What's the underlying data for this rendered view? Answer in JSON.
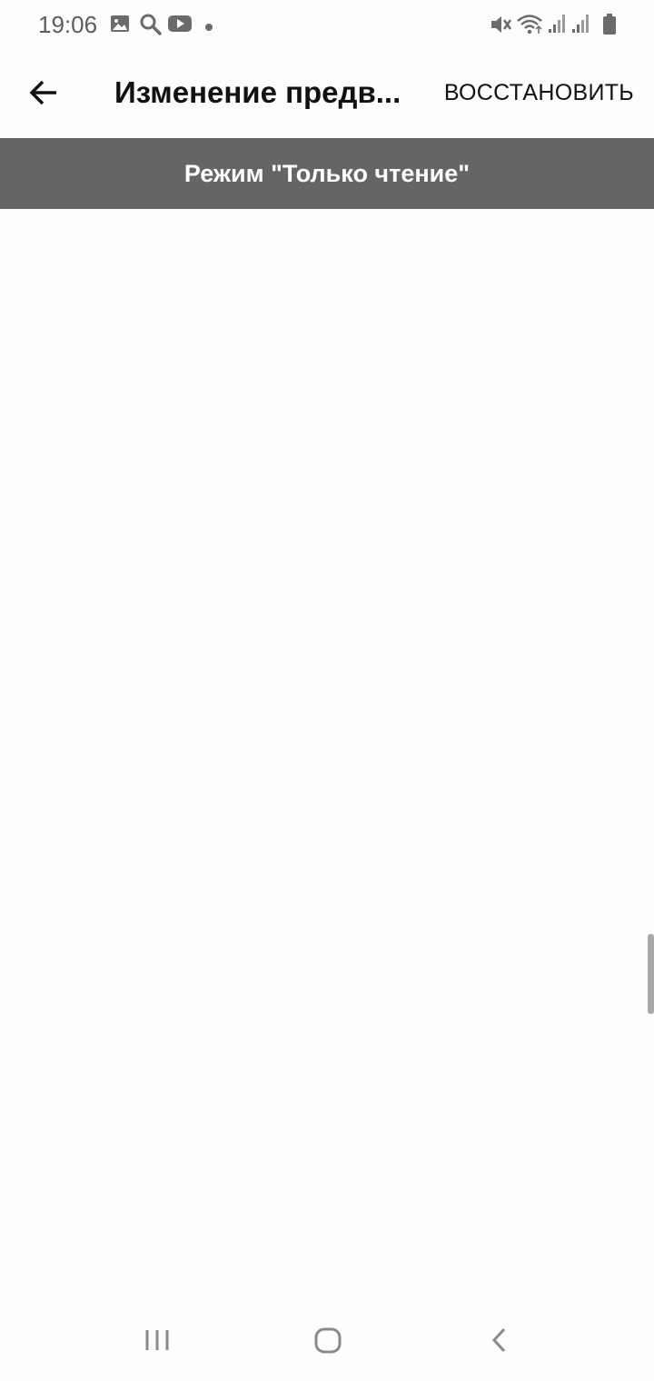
{
  "status_bar": {
    "time": "19:06"
  },
  "app_bar": {
    "title": "Изменение предв...",
    "restore_label": "ВОССТАНОВИТЬ"
  },
  "banner": {
    "text": "Режим \"Только чтение\""
  },
  "icons": {
    "status": [
      "gallery-icon",
      "search-icon",
      "youtube-icon",
      "notification-dot-icon",
      "mute-icon",
      "wifi-icon",
      "signal-icon",
      "signal-icon",
      "battery-icon"
    ],
    "back": "arrow-left-icon",
    "nav": [
      "recents-icon",
      "home-icon",
      "back-icon"
    ]
  },
  "colors": {
    "banner_bg": "#656567",
    "banner_text": "#ffffff",
    "title": "#111111",
    "background": "#fdfdfd"
  }
}
